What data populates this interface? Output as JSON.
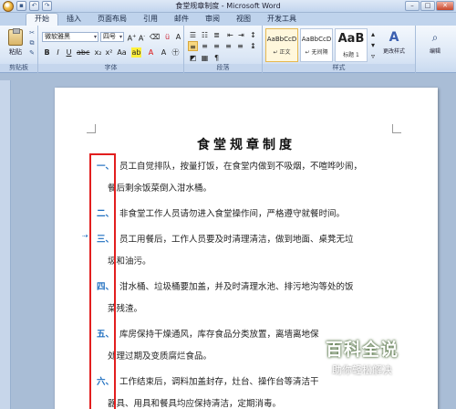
{
  "window": {
    "title": "食堂规章制度 - Microsoft Word"
  },
  "tabs": [
    {
      "label": "开始",
      "active": true
    },
    {
      "label": "插入"
    },
    {
      "label": "页面布局"
    },
    {
      "label": "引用"
    },
    {
      "label": "邮件"
    },
    {
      "label": "审阅"
    },
    {
      "label": "视图"
    },
    {
      "label": "开发工具"
    }
  ],
  "ribbon": {
    "clipboard": {
      "paste_label": "粘贴",
      "group_label": "剪贴板"
    },
    "font": {
      "font_name": "微软雅黑",
      "font_size": "四号",
      "group_label": "字体"
    },
    "paragraph": {
      "group_label": "段落"
    },
    "styles": {
      "group_label": "样式",
      "items": [
        {
          "sample": "AaBbCcD",
          "name": "↵ 正文"
        },
        {
          "sample": "AaBbCcD",
          "name": "↵ 无间隔"
        },
        {
          "sample": "AaB",
          "name": "标题 1"
        }
      ],
      "change_styles_label": "更改样式"
    },
    "editing": {
      "label": "编辑"
    }
  },
  "document": {
    "title": "食堂规章制度",
    "items": [
      {
        "num": "一、",
        "text": "员工自觉排队，按量打饭，在食堂内做到不吸烟，不喧哗吵闹，",
        "cont": "餐后剩余饭菜倒入泔水桶。"
      },
      {
        "num": "二、",
        "text": "非食堂工作人员请勿进入食堂操作间，严格遵守就餐时间。",
        "cont": ""
      },
      {
        "num": "三、",
        "text": "员工用餐后，工作人员要及时清理清洁，做到地面、桌凳无垃",
        "cont": "圾和油污。"
      },
      {
        "num": "四、",
        "text": "泔水桶、垃圾桶要加盖，并及时清理水池、排污地沟等处的饭",
        "cont": "菜残渣。"
      },
      {
        "num": "五、",
        "text": "库房保持干燥通风，库存食品分类放置，离墙离地保",
        "cont": "处理过期及变质腐烂食品。"
      },
      {
        "num": "六、",
        "text": "工作结束后，调料加盖封存，灶台、操作台等清洁干",
        "cont": "器具、用具和餐具均应保持清洁，定期消毒。"
      }
    ]
  },
  "watermark": {
    "main": "百科全说",
    "sub": "助你轻松解决"
  },
  "colors": {
    "accent": "#1f6fc0",
    "highlight_box": "#e21e1e"
  }
}
